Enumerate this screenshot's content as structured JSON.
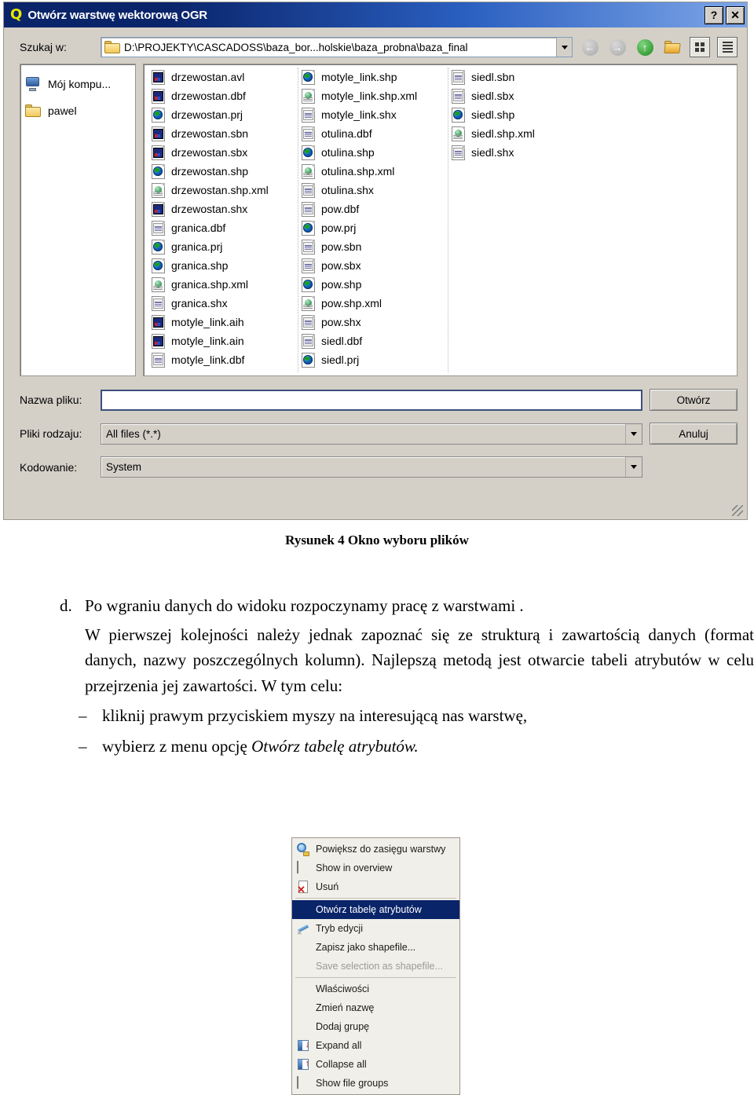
{
  "dialog": {
    "title": "Otwórz warstwę wektorową OGR",
    "title_badge": "Q",
    "help_button": "?",
    "close_button": "✕",
    "lookin_label": "Szukaj w:",
    "lookin_value": "D:\\PROJEKTY\\CASCADOSS\\baza_bor...holskie\\baza_probna\\baza_final",
    "toolbar": [
      {
        "name": "back-icon",
        "glyph": "←"
      },
      {
        "name": "forward-icon",
        "glyph": "→"
      },
      {
        "name": "parent-folder-icon",
        "glyph": "↑"
      },
      {
        "name": "new-folder-icon",
        "glyph": ""
      },
      {
        "name": "list-view-icon",
        "glyph": ""
      },
      {
        "name": "detail-view-icon",
        "glyph": ""
      }
    ],
    "places": [
      {
        "label": "Mój kompu...",
        "icon": "my-computer-icon"
      },
      {
        "label": "pawel",
        "icon": "folder-icon"
      }
    ],
    "file_columns": [
      [
        {
          "name": "drzewostan.avl",
          "icon": "data-file-icon"
        },
        {
          "name": "drzewostan.dbf",
          "icon": "data-file-icon"
        },
        {
          "name": "drzewostan.prj",
          "icon": "globe-file-icon"
        },
        {
          "name": "drzewostan.sbn",
          "icon": "data-file-icon"
        },
        {
          "name": "drzewostan.sbx",
          "icon": "data-file-icon"
        },
        {
          "name": "drzewostan.shp",
          "icon": "globe-file-icon"
        },
        {
          "name": "drzewostan.shp.xml",
          "icon": "xml-file-icon"
        },
        {
          "name": "drzewostan.shx",
          "icon": "data-file-icon"
        },
        {
          "name": "granica.dbf",
          "icon": "table-file-icon"
        },
        {
          "name": "granica.prj",
          "icon": "globe-file-icon"
        },
        {
          "name": "granica.shp",
          "icon": "globe-file-icon"
        },
        {
          "name": "granica.shp.xml",
          "icon": "xml-file-icon"
        },
        {
          "name": "granica.shx",
          "icon": "table-file-icon"
        },
        {
          "name": "motyle_link.aih",
          "icon": "data-file-icon"
        },
        {
          "name": "motyle_link.ain",
          "icon": "data-file-icon"
        },
        {
          "name": "motyle_link.dbf",
          "icon": "table-file-icon"
        }
      ],
      [
        {
          "name": "motyle_link.shp",
          "icon": "globe-file-icon"
        },
        {
          "name": "motyle_link.shp.xml",
          "icon": "xml-file-icon"
        },
        {
          "name": "motyle_link.shx",
          "icon": "table-file-icon"
        },
        {
          "name": "otulina.dbf",
          "icon": "table-file-icon"
        },
        {
          "name": "otulina.shp",
          "icon": "globe-file-icon"
        },
        {
          "name": "otulina.shp.xml",
          "icon": "xml-file-icon"
        },
        {
          "name": "otulina.shx",
          "icon": "table-file-icon"
        },
        {
          "name": "pow.dbf",
          "icon": "table-file-icon"
        },
        {
          "name": "pow.prj",
          "icon": "globe-file-icon"
        },
        {
          "name": "pow.sbn",
          "icon": "table-file-icon"
        },
        {
          "name": "pow.sbx",
          "icon": "table-file-icon"
        },
        {
          "name": "pow.shp",
          "icon": "globe-file-icon"
        },
        {
          "name": "pow.shp.xml",
          "icon": "xml-file-icon"
        },
        {
          "name": "pow.shx",
          "icon": "table-file-icon"
        },
        {
          "name": "siedl.dbf",
          "icon": "table-file-icon"
        },
        {
          "name": "siedl.prj",
          "icon": "globe-file-icon"
        }
      ],
      [
        {
          "name": "siedl.sbn",
          "icon": "table-file-icon"
        },
        {
          "name": "siedl.sbx",
          "icon": "table-file-icon"
        },
        {
          "name": "siedl.shp",
          "icon": "globe-file-icon"
        },
        {
          "name": "siedl.shp.xml",
          "icon": "xml-file-icon"
        },
        {
          "name": "siedl.shx",
          "icon": "table-file-icon"
        }
      ]
    ],
    "filename_label": "Nazwa pliku:",
    "filename_value": "",
    "filetype_label": "Pliki rodzaju:",
    "filetype_value": "All files (*.*)",
    "encoding_label": "Kodowanie:",
    "encoding_value": "System",
    "open_button": "Otwórz",
    "cancel_button": "Anuluj"
  },
  "document": {
    "figure_caption": "Rysunek 4 Okno wyboru plików",
    "item_marker": "d.",
    "item_text": "Po wgraniu danych do widoku rozpoczynamy pracę z warstwami .",
    "paragraph": "W pierwszej kolejności należy jednak zapoznać się ze strukturą i zawartością danych (format danych, nazwy poszczególnych kolumn). Najlepszą metodą jest otwarcie tabeli atrybutów w celu przejrzenia jej zawartości. W tym celu:",
    "dash_marker": "–",
    "bullet_1": "kliknij prawym przyciskiem myszy na interesującą nas warstwę,",
    "bullet_2_pre": "wybierz z menu opcję ",
    "bullet_2_italic": "Otwórz tabelę atrybutów."
  },
  "context_menu": {
    "items": [
      {
        "label": "Powiększ do zasięgu warstwy",
        "icon": "zoom-to-layer-icon",
        "state": "normal"
      },
      {
        "label": "Show in overview",
        "icon": "checkbox-icon",
        "state": "normal"
      },
      {
        "label": "Usuń",
        "icon": "delete-icon",
        "state": "normal"
      },
      {
        "label": "Otwórz tabelę atrybutów",
        "icon": "none",
        "state": "selected"
      },
      {
        "label": "Tryb edycji",
        "icon": "edit-pen-icon",
        "state": "normal"
      },
      {
        "label": "Zapisz jako shapefile...",
        "icon": "none",
        "state": "normal"
      },
      {
        "label": "Save selection as shapefile...",
        "icon": "none",
        "state": "disabled"
      },
      {
        "label": "Właściwości",
        "icon": "none",
        "state": "normal"
      },
      {
        "label": "Zmień nazwę",
        "icon": "none",
        "state": "normal"
      },
      {
        "label": "Dodaj grupę",
        "icon": "none",
        "state": "normal"
      },
      {
        "label": "Expand all",
        "icon": "expand-all-icon",
        "state": "normal"
      },
      {
        "label": "Collapse all",
        "icon": "collapse-all-icon",
        "state": "normal"
      },
      {
        "label": "Show file groups",
        "icon": "checkbox-icon",
        "state": "normal"
      }
    ]
  },
  "colors": {
    "title_bar_start": "#0a246a",
    "title_bar_end": "#7ea6e8",
    "dialog_face": "#d4d0c8",
    "selection": "#0a246a",
    "field_border": "#3c4f7c"
  }
}
